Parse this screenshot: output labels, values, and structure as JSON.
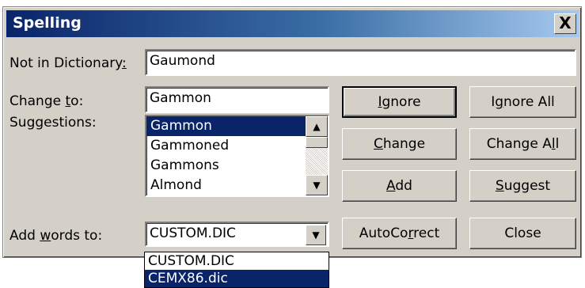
{
  "window": {
    "title": "Spelling",
    "close_glyph": "X"
  },
  "not_in_dictionary": {
    "label_pre": "Not in Dictionary",
    "label_u": ":",
    "value": "Gaumond"
  },
  "change_to": {
    "label_pre": "Change ",
    "label_u": "t",
    "label_post": "o:",
    "value": "Gammon"
  },
  "suggestions": {
    "label": "Suggestions:",
    "items": [
      "Gammon",
      "Gammoned",
      "Gammons",
      "Almond"
    ],
    "selected_index": 0
  },
  "add_words_to": {
    "label_pre": "Add ",
    "label_u": "w",
    "label_post": "ords to:",
    "value": "CUSTOM.DIC",
    "options": [
      "CUSTOM.DIC",
      "CEMX86.dic"
    ],
    "highlighted_index": 1
  },
  "buttons": {
    "ignore": {
      "pre": "",
      "u": "I",
      "post": "gnore"
    },
    "ignore_all": {
      "pre": "I",
      "u": "g",
      "post": "nore All"
    },
    "change": {
      "pre": "",
      "u": "C",
      "post": "hange"
    },
    "change_all": {
      "pre": "Change A",
      "u": "l",
      "post": "l"
    },
    "add": {
      "pre": "",
      "u": "A",
      "post": "dd"
    },
    "suggest": {
      "pre": "",
      "u": "S",
      "post": "uggest"
    },
    "autocorrect": {
      "pre": "AutoCo",
      "u": "r",
      "post": "rect"
    },
    "close": {
      "pre": "Close",
      "u": "",
      "post": ""
    }
  },
  "icons": {
    "scroll_up": "▲",
    "scroll_down": "▼",
    "combo_arrow": "▼"
  },
  "colors": {
    "selection": "#0a246a",
    "title_start": "#0a246a",
    "title_end": "#a6caf0",
    "face": "#d4d0c8"
  }
}
